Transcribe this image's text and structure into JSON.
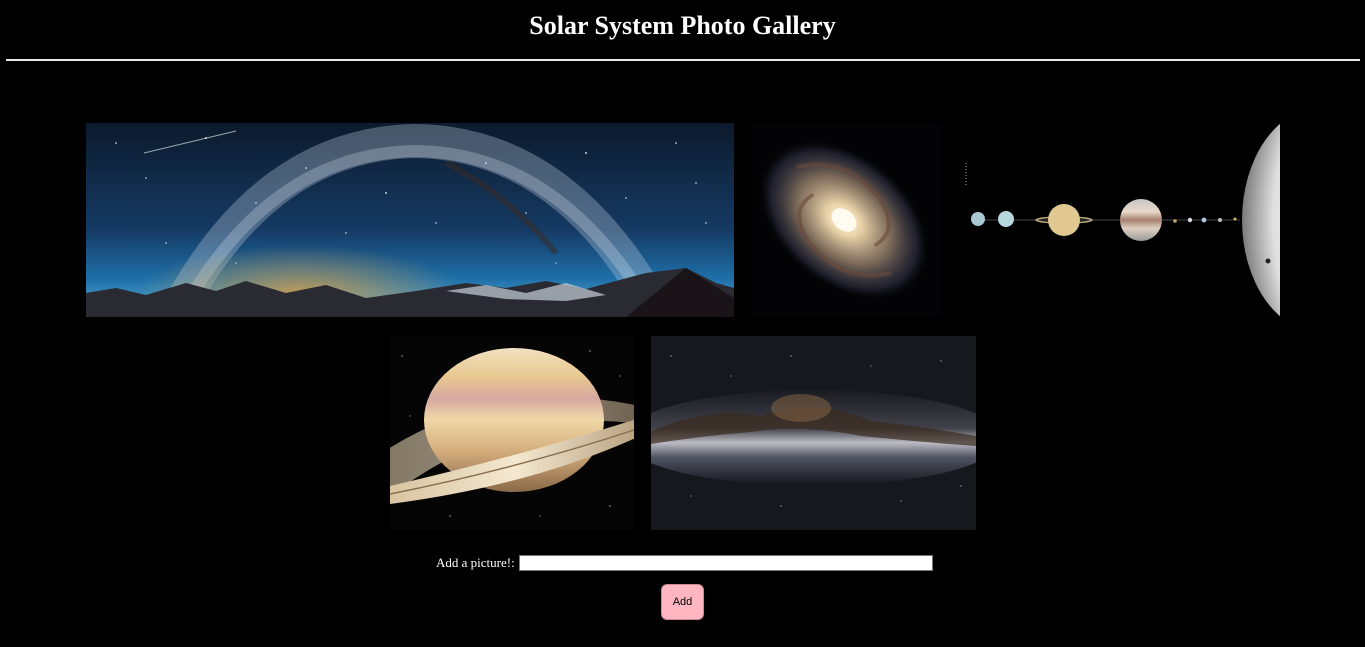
{
  "header": {
    "title": "Solar System Photo Gallery"
  },
  "gallery": {
    "photos": [
      {
        "subject": "milky-way-panorama-over-mountains"
      },
      {
        "subject": "spiral-galaxy"
      },
      {
        "subject": "solar-system-planets-lineup"
      },
      {
        "subject": "saturn"
      },
      {
        "subject": "milky-way-core"
      }
    ]
  },
  "add_form": {
    "label": "Add a picture!:",
    "input_value": "",
    "input_placeholder": "",
    "button_label": "Add"
  },
  "colors": {
    "background": "#000000",
    "text": "#ffffff",
    "button": "#ffb6c1"
  }
}
